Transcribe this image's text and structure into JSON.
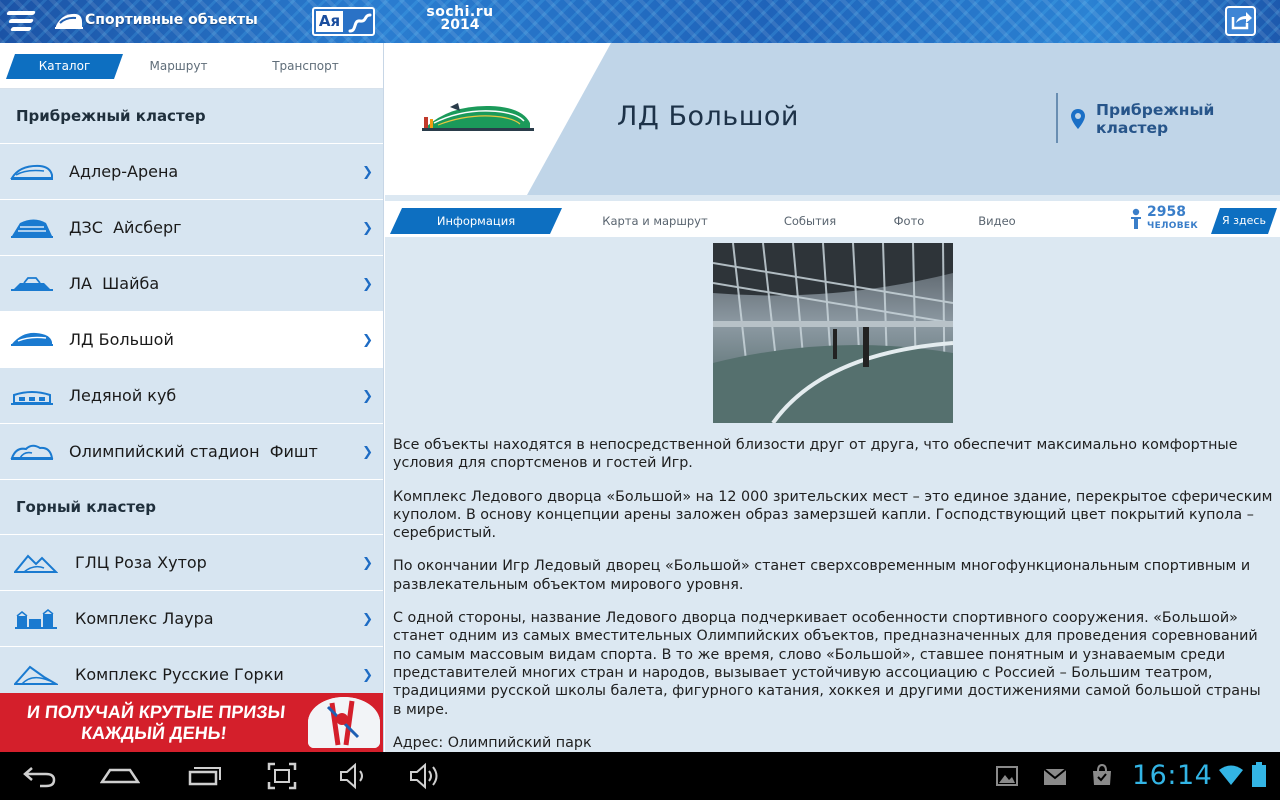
{
  "topbar": {
    "title": "Спортивные объекты",
    "lang_label": "Ая",
    "logo_line1": "sochi.ru",
    "logo_line2": "2014"
  },
  "sidebar": {
    "tabs": [
      {
        "label": "Каталог",
        "active": true
      },
      {
        "label": "Маршрут",
        "active": false
      },
      {
        "label": "Транспорт",
        "active": false
      }
    ],
    "clusters": [
      {
        "name": "Прибрежный кластер",
        "venues": [
          {
            "name": "Адлер-Арена",
            "icon": "arena-icon"
          },
          {
            "name": "ДЗС  Айсберг",
            "icon": "iceberg-icon"
          },
          {
            "name": "ЛА  Шайба",
            "icon": "shayba-icon"
          },
          {
            "name": "ЛД Большой",
            "icon": "bolshoy-icon",
            "selected": true
          },
          {
            "name": "Ледяной куб",
            "icon": "ice-cube-icon"
          },
          {
            "name": "Олимпийский стадион  Фишт",
            "icon": "fisht-icon"
          }
        ]
      },
      {
        "name": "Горный кластер",
        "venues": [
          {
            "name": "ГЛЦ Роза Хутор",
            "icon": "mountain-icon"
          },
          {
            "name": "Комплекс Лаура",
            "icon": "laura-icon"
          },
          {
            "name": "Комплекс Русские Горки",
            "icon": "jump-icon"
          }
        ]
      }
    ],
    "chevron": "❯",
    "ad": {
      "line1": "И ПОЛУЧАЙ КРУТЫЕ ПРИЗЫ",
      "line2": "КАЖДЫЙ ДЕНЬ!"
    }
  },
  "venue": {
    "title": "ЛД Большой",
    "cluster_line1": "Прибрежный",
    "cluster_line2": "кластер",
    "tabs": [
      {
        "label": "Информация",
        "active": true
      },
      {
        "label": "Карта и маршрут",
        "active": false
      },
      {
        "label": "События",
        "active": false
      },
      {
        "label": "Фото",
        "active": false
      },
      {
        "label": "Видео",
        "active": false
      }
    ],
    "people_count": "2958",
    "people_label": "ЧЕЛОВЕК",
    "here_label": "Я здесь",
    "paragraphs": [
      "Все объекты находятся в непосредственной близости друг от друга, что обеспечит максимально комфортные условия для спортсменов и гостей Игр.",
      "Комплекс Ледового дворца «Большой» на 12 000 зрительских мест – это единое здание, перекрытое сферическим куполом. В основу концепции арены заложен образ замерзшей капли. Господствующий цвет покрытий купола – серебристый.",
      "По окончании Игр Ледовый дворец «Большой» станет сверхсовременным многофункциональным спортивным и развлекательным объектом мирового уровня.",
      "С одной стороны, название Ледового дворца подчеркивает особенности спортивного сооружения. «Большой» станет одним из самых вместительных Олимпийских объектов, предназначенных для проведения соревнований по самым массовым видам спорта. В то же время, слово «Большой», ставшее понятным и узнаваемым среди представителей многих стран и народов, вызывает устойчивую ассоциацию с Россией – Большим театром, традициями русской школы балета, фигурного катания, хоккея и другими достижениями самой большой страны в мире.",
      "Адрес: Олимпийский парк"
    ]
  },
  "statusbar": {
    "time": "16:14",
    "accent": "#33b5e5"
  }
}
